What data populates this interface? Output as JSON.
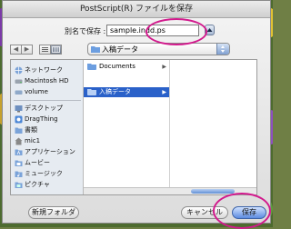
{
  "window": {
    "title": "PostScript(R) ファイルを保存"
  },
  "save_as": {
    "label": "別名で保存 :",
    "value": "sample.indd.ps"
  },
  "location_popup": {
    "value": "入稿データ"
  },
  "sidebar": {
    "devices": [
      {
        "label": "ネットワーク",
        "icon": "network-icon"
      },
      {
        "label": "Macintosh HD",
        "icon": "hard-drive-icon"
      },
      {
        "label": "volume",
        "icon": "volume-icon"
      }
    ],
    "places": [
      {
        "label": "デスクトップ",
        "icon": "desktop-icon"
      },
      {
        "label": "DragThing",
        "icon": "dragthing-icon"
      },
      {
        "label": "書類",
        "icon": "documents-folder-icon"
      },
      {
        "label": "mic1",
        "icon": "home-icon"
      },
      {
        "label": "アプリケーション",
        "icon": "applications-icon"
      },
      {
        "label": "ムービー",
        "icon": "movies-icon"
      },
      {
        "label": "ミュージック",
        "icon": "music-icon"
      },
      {
        "label": "ピクチャ",
        "icon": "pictures-icon"
      }
    ]
  },
  "columns": {
    "col1": [
      {
        "label": "Documents",
        "has_children": true
      }
    ],
    "col2": [
      {
        "label": "入稿データ",
        "selected": true,
        "has_children": true
      }
    ]
  },
  "buttons": {
    "new_folder": "新規フォルダ",
    "cancel": "キャンセル",
    "save": "保存"
  },
  "colors": {
    "accent": "#2a61c9",
    "highlight_ring": "#d21a8d"
  }
}
